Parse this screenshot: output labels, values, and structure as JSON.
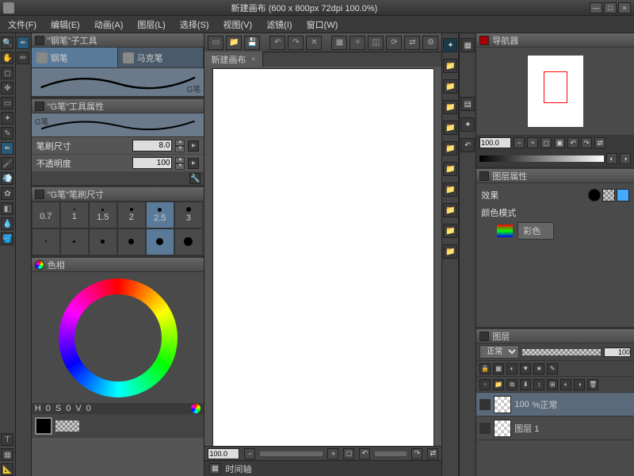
{
  "title": "新建画布 (600 x 800px 72dpi 100.0%)",
  "menu": {
    "file": "文件(F)",
    "edit": "编辑(E)",
    "anim": "动画(A)",
    "layer": "图层(L)",
    "select": "选择(S)",
    "view": "视图(V)",
    "filter": "滤镜(I)",
    "window": "窗口(W)"
  },
  "subtool_panel_title": "\"钢笔\"子工具",
  "subtool": {
    "pen": "钢笔",
    "marker": "马克笔",
    "brush_name": "G笔"
  },
  "prop_panel_title": "\"G笔\"工具属性",
  "prop": {
    "brush_label": "G笔",
    "size_label": "笔刷尺寸",
    "size_value": "8.0",
    "opacity_label": "不透明度",
    "opacity_value": "100"
  },
  "size_panel_title": "\"G笔\"笔刷尺寸",
  "sizes": [
    "0.7",
    "1",
    "1.5",
    "2",
    "2.5",
    "3"
  ],
  "color_panel_title": "色相",
  "hsv": {
    "h_label": "H",
    "h": "0",
    "s_label": "S",
    "s": "0",
    "v_label": "V",
    "v": "0"
  },
  "tab_name": "新建画布",
  "zoom": "100.0",
  "timeline_label": "时间轴",
  "nav": {
    "title": "导航器",
    "zoom": "100.0"
  },
  "layerprop": {
    "title": "图层属性",
    "effect_label": "效果",
    "colormode_label": "颜色模式",
    "colormode_value": "彩色"
  },
  "layers": {
    "title": "图层",
    "blend": "正常",
    "opacity": "100",
    "layer1_opacity": "100",
    "layer1_name": "%正常",
    "layer2_name": "图层 1"
  }
}
